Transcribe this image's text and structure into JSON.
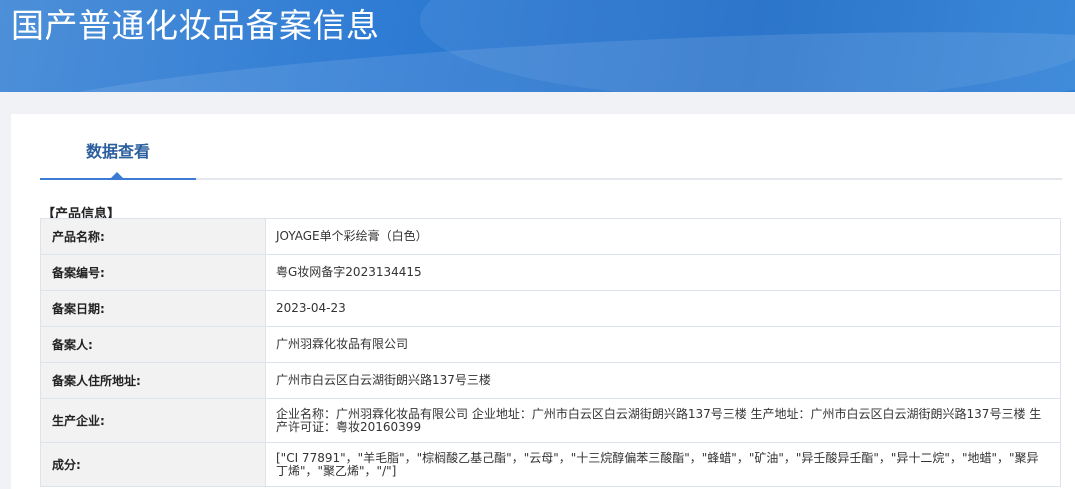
{
  "header": {
    "title": "国产普通化妆品备案信息"
  },
  "tabs": [
    {
      "label": "数据查看"
    }
  ],
  "section": {
    "title": "【产品信息】"
  },
  "rows": [
    {
      "label": "产品名称:",
      "value": "JOYAGE单个彩绘膏（白色）"
    },
    {
      "label": "备案编号:",
      "value": "粤G妆网备字2023134415"
    },
    {
      "label": "备案日期:",
      "value": "2023-04-23"
    },
    {
      "label": "备案人:",
      "value": "广州羽霖化妆品有限公司"
    },
    {
      "label": "备案人住所地址:",
      "value": "广州市白云区白云湖街朗兴路137号三楼"
    },
    {
      "label": "生产企业:",
      "value": "企业名称：广州羽霖化妆品有限公司 企业地址：广州市白云区白云湖街朗兴路137号三楼 生产地址：广州市白云区白云湖街朗兴路137号三楼 生产许可证：粤妆20160399"
    },
    {
      "label": "成分:",
      "value": "[\"CI 77891\"，\"羊毛脂\"，\"棕榈酸乙基己酯\"，\"云母\"，\"十三烷醇偏苯三酸酯\"，\"蜂蜡\"，\"矿油\"，\"异壬酸异壬酯\"，\"异十二烷\"，\"地蜡\"，\"聚异丁烯\"，\"聚乙烯\"，\"/\"]"
    }
  ],
  "colors": {
    "banner": "#2f7cd4",
    "tab_accent": "#3a7bd5",
    "tab_text": "#2c5f9e",
    "label_bg": "#f2f2f2"
  }
}
